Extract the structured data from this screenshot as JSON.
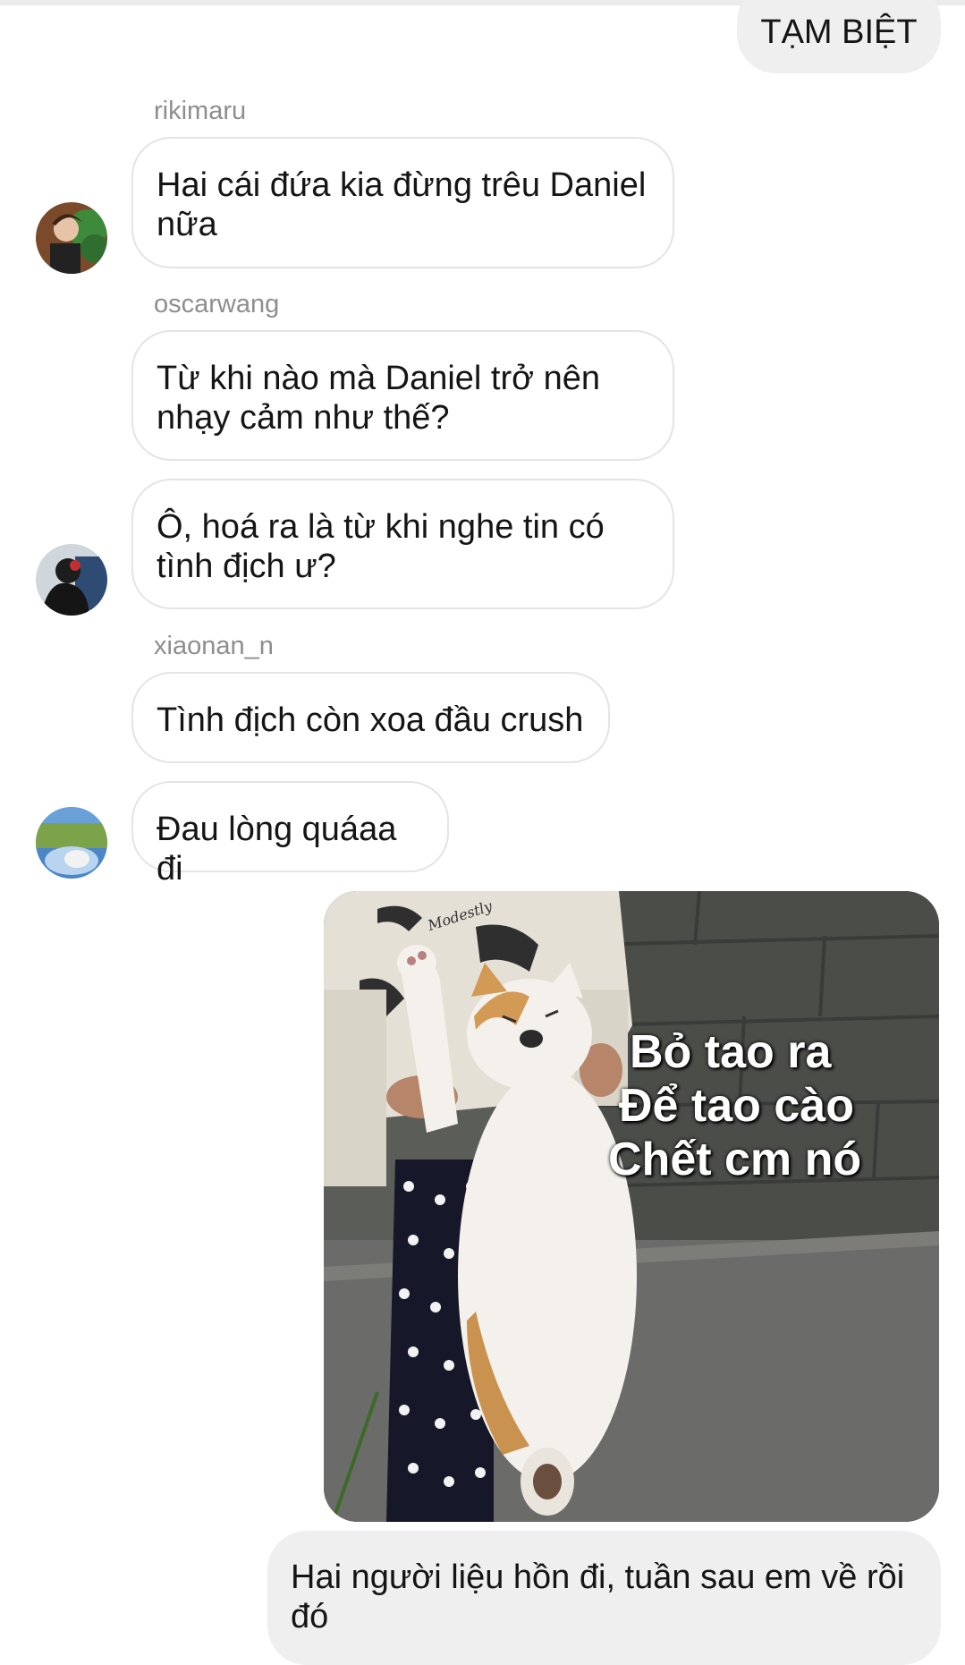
{
  "messages": [
    {
      "type": "sent",
      "text": "TẠM BIỆT"
    },
    {
      "type": "received",
      "sender": "rikimaru",
      "text": "Hai cái đứa kia đừng trêu Daniel nữa"
    },
    {
      "type": "received",
      "sender": "oscarwang",
      "text": "Từ khi nào mà Daniel trở nên nhạy cảm như thế?"
    },
    {
      "type": "received",
      "text": "Ô, hoá ra là từ khi nghe tin có tình địch ư?"
    },
    {
      "type": "received",
      "sender": "xiaonan_n",
      "text": "Tình địch còn xoa đầu crush"
    },
    {
      "type": "received",
      "text": "Đau lòng quáaa đi"
    },
    {
      "type": "sent",
      "text": "Hai người liệu hồn đi, tuần sau em về rồi đó"
    }
  ],
  "meme": {
    "caption": [
      "Bỏ tao ra",
      "Để tao cào",
      "Chết cm nó"
    ],
    "shirt_text": "Modestly"
  },
  "colors": {
    "sent_bubble": "#efefef",
    "received_border": "#e4e4e4",
    "username": "#8e8e8e"
  }
}
